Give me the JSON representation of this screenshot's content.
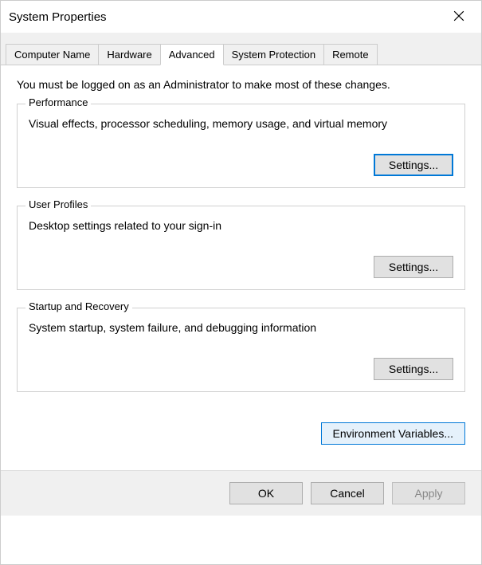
{
  "window": {
    "title": "System Properties"
  },
  "tabs": {
    "computer_name": "Computer Name",
    "hardware": "Hardware",
    "advanced": "Advanced",
    "system_protection": "System Protection",
    "remote": "Remote"
  },
  "admin_notice": "You must be logged on as an Administrator to make most of these changes.",
  "groups": {
    "performance": {
      "title": "Performance",
      "desc": "Visual effects, processor scheduling, memory usage, and virtual memory",
      "button": "Settings..."
    },
    "user_profiles": {
      "title": "User Profiles",
      "desc": "Desktop settings related to your sign-in",
      "button": "Settings..."
    },
    "startup_recovery": {
      "title": "Startup and Recovery",
      "desc": "System startup, system failure, and debugging information",
      "button": "Settings..."
    }
  },
  "env_button": "Environment Variables...",
  "footer": {
    "ok": "OK",
    "cancel": "Cancel",
    "apply": "Apply"
  }
}
